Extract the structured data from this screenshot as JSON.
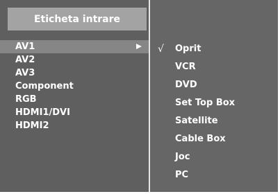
{
  "header": {
    "title": "Eticheta intrare"
  },
  "inputs": [
    {
      "label": "AV1"
    },
    {
      "label": "AV2"
    },
    {
      "label": "AV3"
    },
    {
      "label": "Component"
    },
    {
      "label": "RGB"
    },
    {
      "label": "HDMI1/DVI"
    },
    {
      "label": "HDMI2"
    }
  ],
  "selected_input": "AV1",
  "label_options": [
    {
      "label": "Oprit"
    },
    {
      "label": "VCR"
    },
    {
      "label": "DVD"
    },
    {
      "label": "Set Top Box"
    },
    {
      "label": "Satellite"
    },
    {
      "label": "Cable Box"
    },
    {
      "label": "Joc"
    },
    {
      "label": "PC"
    }
  ],
  "checked_option": "Oprit",
  "icons": {
    "submenu_arrow": "triangle-right-icon",
    "check": "check-icon"
  },
  "colors": {
    "panel": "#666666",
    "left_column": "#5f5f5f",
    "header": "#a3a3a3",
    "selected_row": "#868686",
    "text": "#ffffff"
  }
}
